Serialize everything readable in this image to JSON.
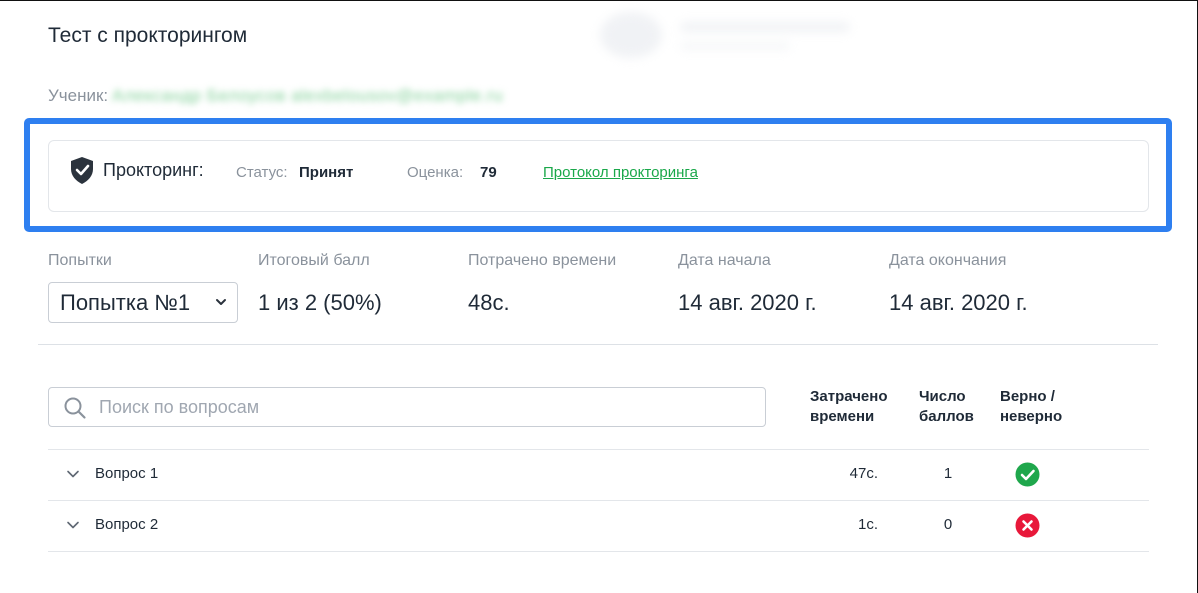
{
  "page": {
    "title": "Тест с прокторингом"
  },
  "student": {
    "label": "Ученик:",
    "name": "Александр Белоусов alexbelousov@example.ru"
  },
  "proctoring": {
    "label": "Прокторинг:",
    "status_label": "Статус:",
    "status_value": "Принят",
    "score_label": "Оценка:",
    "score_value": "79",
    "protocol_link": "Протокол прокторинга",
    "icon": "shield-check-icon"
  },
  "stats": {
    "attempts_label": "Попытки",
    "attempt_selected": "Попытка №1",
    "total_score_label": "Итоговый балл",
    "total_score_value": "1 из 2 (50%)",
    "time_spent_label": "Потрачено времени",
    "time_spent_value": "48с.",
    "start_date_label": "Дата начала",
    "start_date_value": "14 авг. 2020 г.",
    "end_date_label": "Дата окончания",
    "end_date_value": "14 авг. 2020 г."
  },
  "questions": {
    "search_placeholder": "Поиск по вопросам",
    "col_time": "Затрачено\nвремени",
    "col_points": "Число\nбаллов",
    "col_correct": "Верно /\nневерно",
    "rows": [
      {
        "title": "Вопрос 1",
        "time": "47с.",
        "points": "1",
        "correct": true
      },
      {
        "title": "Вопрос 2",
        "time": "1с.",
        "points": "0",
        "correct": false
      }
    ]
  },
  "colors": {
    "accent_green": "#1aa84a",
    "correct": "#1fa74c",
    "incorrect": "#e8183a",
    "highlight": "#2e7ff0"
  }
}
